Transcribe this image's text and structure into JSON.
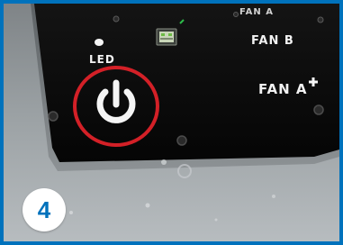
{
  "panel": {
    "led_label": "LED",
    "fan_top_label": "FAN A",
    "fan_b_label": "FAN B",
    "fan_a_label": "FAN A"
  },
  "icons": {
    "power": "power-icon",
    "led": "led-indicator-icon",
    "network": "network-port-icon",
    "highlight": "highlight-circle"
  },
  "step_badge": {
    "number": "4"
  },
  "colors": {
    "frame": "#0072bc",
    "highlight": "#d32027",
    "panel": "#0d0d0d",
    "badge_text": "#0072bc"
  }
}
